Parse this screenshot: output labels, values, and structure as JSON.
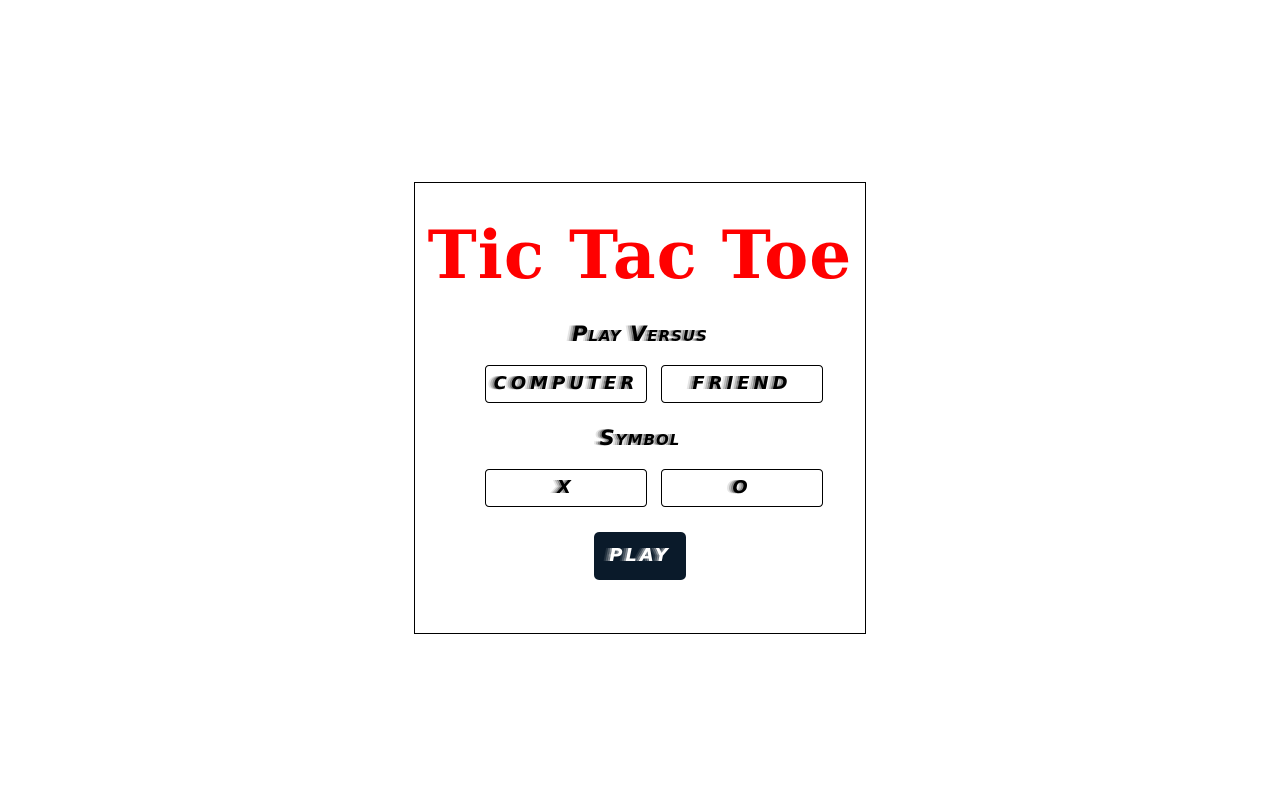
{
  "game": {
    "title": "Tic Tac Toe",
    "title_color": "#ff0000",
    "versus": {
      "label": "Play Versus",
      "options": [
        "COMPUTER",
        "FRIEND"
      ]
    },
    "symbol": {
      "label": "Symbol",
      "options": [
        "X",
        "O"
      ]
    },
    "play_label": "PLAY",
    "play_button_color": "#0a1a2a"
  }
}
